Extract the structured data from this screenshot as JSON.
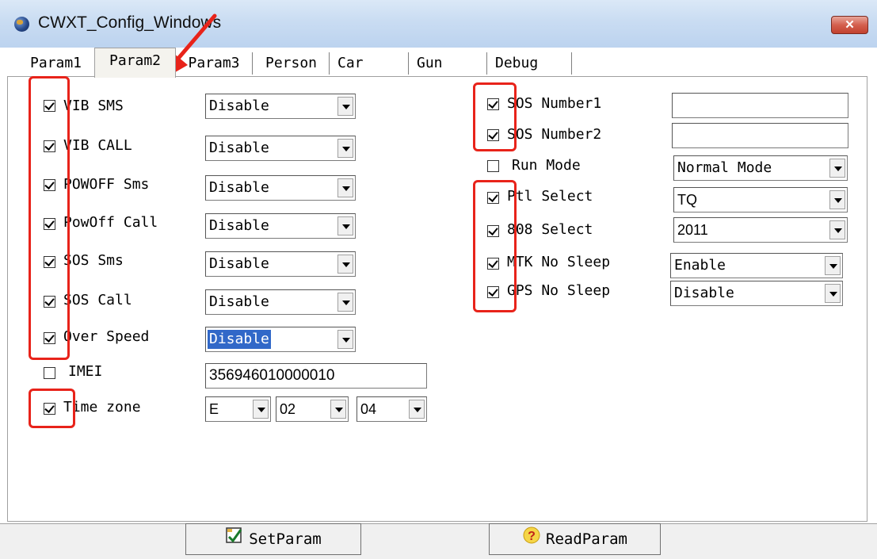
{
  "window": {
    "title": "CWXT_Config_Windows",
    "close_label": "✕"
  },
  "tabs": [
    "Param1",
    "Param2",
    "Param3",
    "Person",
    "Car",
    "Gun",
    "Debug"
  ],
  "active_tab": "Param2",
  "left": {
    "rows": [
      {
        "label": "VIB SMS",
        "checked": true,
        "value": "Disable"
      },
      {
        "label": "VIB CALL",
        "checked": true,
        "value": "Disable"
      },
      {
        "label": "POWOFF Sms",
        "checked": true,
        "value": "Disable"
      },
      {
        "label": "PowOff Call",
        "checked": true,
        "value": "Disable"
      },
      {
        "label": "SOS Sms",
        "checked": true,
        "value": "Disable"
      },
      {
        "label": "SOS Call",
        "checked": true,
        "value": "Disable"
      },
      {
        "label": "Over Speed",
        "checked": true,
        "value": "Disable"
      }
    ],
    "imei": {
      "label": "IMEI",
      "checked": false,
      "value": "356946010000010"
    },
    "timezone": {
      "label": "Time zone",
      "checked": true,
      "dir": "E",
      "hours": "02",
      "minutes": "04"
    }
  },
  "right": {
    "sos1": {
      "label": "SOS Number1",
      "checked": true,
      "value": ""
    },
    "sos2": {
      "label": "SOS Number2",
      "checked": true,
      "value": ""
    },
    "run_mode": {
      "label": "Run Mode",
      "checked": false,
      "value": "Normal Mode"
    },
    "ptl": {
      "label": "Ptl Select",
      "checked": true,
      "value": "TQ"
    },
    "s808": {
      "label": "808 Select",
      "checked": true,
      "value": "2011"
    },
    "mtk": {
      "label": "MTK No Sleep",
      "checked": true,
      "value": "Enable"
    },
    "gps": {
      "label": "GPS No Sleep",
      "checked": true,
      "value": "Disable"
    }
  },
  "buttons": {
    "set": "SetParam",
    "read": "ReadParam"
  },
  "colors": {
    "highlight_box": "#e8231a",
    "selection": "#3168c8"
  }
}
